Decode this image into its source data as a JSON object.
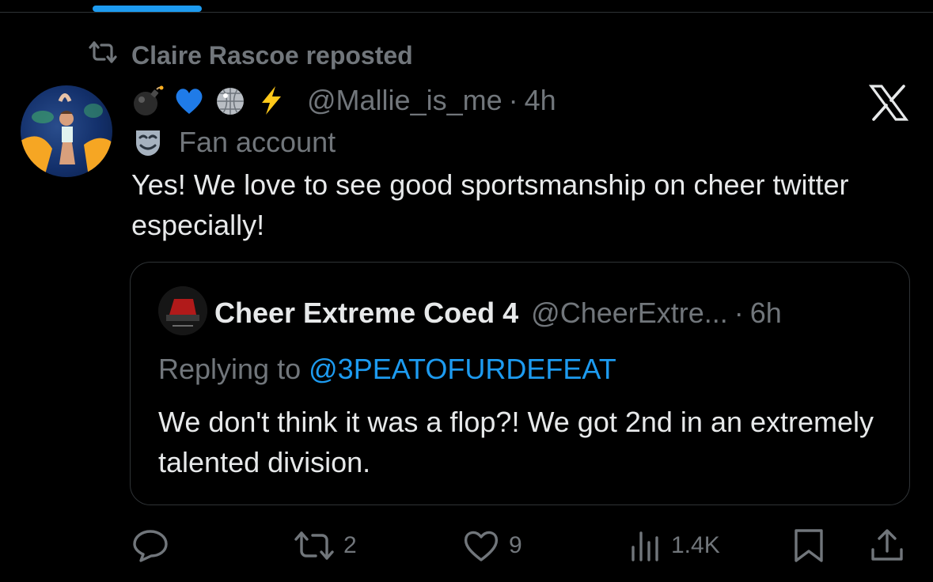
{
  "colors": {
    "background": "#000000",
    "text": "#e7e9ea",
    "muted": "#71767b",
    "accent": "#1d9bf0",
    "border": "#2f3336"
  },
  "repost": {
    "icon": "repost-icon",
    "label": "Claire Rascoe reposted"
  },
  "tweet": {
    "avatar": "avatar",
    "name_emojis": [
      "bomb-emoji",
      "blue-heart-emoji",
      "disco-ball-emoji",
      "lightning-emoji"
    ],
    "handle": "@Mallie_is_me",
    "separator": "·",
    "time": "4h",
    "label_icon": "theater-mask-icon",
    "label": "Fan account",
    "text": "Yes! We love to see good sportsmanship on cheer twitter especially!"
  },
  "quote": {
    "name": "Cheer Extreme Coed 4",
    "handle": "@CheerExtre...",
    "separator": "·",
    "time": "6h",
    "reply_prefix": "Replying to",
    "reply_mention": "@3PEATOFURDEFEAT",
    "text": "We don't think it was a flop?! We got 2nd in an extremely talented division."
  },
  "actions": {
    "reply": {
      "icon": "reply-icon",
      "count": ""
    },
    "repost": {
      "icon": "repost-icon",
      "count": "2"
    },
    "like": {
      "icon": "heart-icon",
      "count": "9"
    },
    "views": {
      "icon": "views-icon",
      "count": "1.4K"
    },
    "bookmark": {
      "icon": "bookmark-icon"
    },
    "share": {
      "icon": "share-icon"
    }
  }
}
